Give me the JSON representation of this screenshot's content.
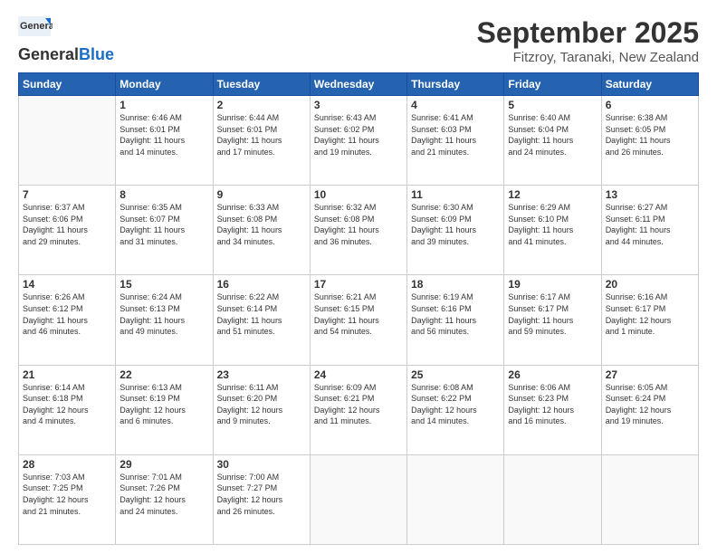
{
  "header": {
    "logo_general": "General",
    "logo_blue": "Blue",
    "month": "September 2025",
    "location": "Fitzroy, Taranaki, New Zealand"
  },
  "weekdays": [
    "Sunday",
    "Monday",
    "Tuesday",
    "Wednesday",
    "Thursday",
    "Friday",
    "Saturday"
  ],
  "weeks": [
    [
      {
        "day": "",
        "info": ""
      },
      {
        "day": "1",
        "info": "Sunrise: 6:46 AM\nSunset: 6:01 PM\nDaylight: 11 hours\nand 14 minutes."
      },
      {
        "day": "2",
        "info": "Sunrise: 6:44 AM\nSunset: 6:01 PM\nDaylight: 11 hours\nand 17 minutes."
      },
      {
        "day": "3",
        "info": "Sunrise: 6:43 AM\nSunset: 6:02 PM\nDaylight: 11 hours\nand 19 minutes."
      },
      {
        "day": "4",
        "info": "Sunrise: 6:41 AM\nSunset: 6:03 PM\nDaylight: 11 hours\nand 21 minutes."
      },
      {
        "day": "5",
        "info": "Sunrise: 6:40 AM\nSunset: 6:04 PM\nDaylight: 11 hours\nand 24 minutes."
      },
      {
        "day": "6",
        "info": "Sunrise: 6:38 AM\nSunset: 6:05 PM\nDaylight: 11 hours\nand 26 minutes."
      }
    ],
    [
      {
        "day": "7",
        "info": "Sunrise: 6:37 AM\nSunset: 6:06 PM\nDaylight: 11 hours\nand 29 minutes."
      },
      {
        "day": "8",
        "info": "Sunrise: 6:35 AM\nSunset: 6:07 PM\nDaylight: 11 hours\nand 31 minutes."
      },
      {
        "day": "9",
        "info": "Sunrise: 6:33 AM\nSunset: 6:08 PM\nDaylight: 11 hours\nand 34 minutes."
      },
      {
        "day": "10",
        "info": "Sunrise: 6:32 AM\nSunset: 6:08 PM\nDaylight: 11 hours\nand 36 minutes."
      },
      {
        "day": "11",
        "info": "Sunrise: 6:30 AM\nSunset: 6:09 PM\nDaylight: 11 hours\nand 39 minutes."
      },
      {
        "day": "12",
        "info": "Sunrise: 6:29 AM\nSunset: 6:10 PM\nDaylight: 11 hours\nand 41 minutes."
      },
      {
        "day": "13",
        "info": "Sunrise: 6:27 AM\nSunset: 6:11 PM\nDaylight: 11 hours\nand 44 minutes."
      }
    ],
    [
      {
        "day": "14",
        "info": "Sunrise: 6:26 AM\nSunset: 6:12 PM\nDaylight: 11 hours\nand 46 minutes."
      },
      {
        "day": "15",
        "info": "Sunrise: 6:24 AM\nSunset: 6:13 PM\nDaylight: 11 hours\nand 49 minutes."
      },
      {
        "day": "16",
        "info": "Sunrise: 6:22 AM\nSunset: 6:14 PM\nDaylight: 11 hours\nand 51 minutes."
      },
      {
        "day": "17",
        "info": "Sunrise: 6:21 AM\nSunset: 6:15 PM\nDaylight: 11 hours\nand 54 minutes."
      },
      {
        "day": "18",
        "info": "Sunrise: 6:19 AM\nSunset: 6:16 PM\nDaylight: 11 hours\nand 56 minutes."
      },
      {
        "day": "19",
        "info": "Sunrise: 6:17 AM\nSunset: 6:17 PM\nDaylight: 11 hours\nand 59 minutes."
      },
      {
        "day": "20",
        "info": "Sunrise: 6:16 AM\nSunset: 6:17 PM\nDaylight: 12 hours\nand 1 minute."
      }
    ],
    [
      {
        "day": "21",
        "info": "Sunrise: 6:14 AM\nSunset: 6:18 PM\nDaylight: 12 hours\nand 4 minutes."
      },
      {
        "day": "22",
        "info": "Sunrise: 6:13 AM\nSunset: 6:19 PM\nDaylight: 12 hours\nand 6 minutes."
      },
      {
        "day": "23",
        "info": "Sunrise: 6:11 AM\nSunset: 6:20 PM\nDaylight: 12 hours\nand 9 minutes."
      },
      {
        "day": "24",
        "info": "Sunrise: 6:09 AM\nSunset: 6:21 PM\nDaylight: 12 hours\nand 11 minutes."
      },
      {
        "day": "25",
        "info": "Sunrise: 6:08 AM\nSunset: 6:22 PM\nDaylight: 12 hours\nand 14 minutes."
      },
      {
        "day": "26",
        "info": "Sunrise: 6:06 AM\nSunset: 6:23 PM\nDaylight: 12 hours\nand 16 minutes."
      },
      {
        "day": "27",
        "info": "Sunrise: 6:05 AM\nSunset: 6:24 PM\nDaylight: 12 hours\nand 19 minutes."
      }
    ],
    [
      {
        "day": "28",
        "info": "Sunrise: 7:03 AM\nSunset: 7:25 PM\nDaylight: 12 hours\nand 21 minutes."
      },
      {
        "day": "29",
        "info": "Sunrise: 7:01 AM\nSunset: 7:26 PM\nDaylight: 12 hours\nand 24 minutes."
      },
      {
        "day": "30",
        "info": "Sunrise: 7:00 AM\nSunset: 7:27 PM\nDaylight: 12 hours\nand 26 minutes."
      },
      {
        "day": "",
        "info": ""
      },
      {
        "day": "",
        "info": ""
      },
      {
        "day": "",
        "info": ""
      },
      {
        "day": "",
        "info": ""
      }
    ]
  ]
}
